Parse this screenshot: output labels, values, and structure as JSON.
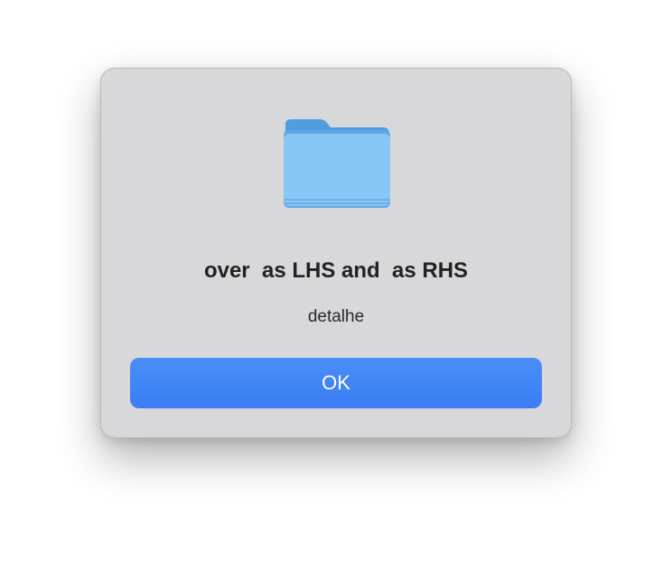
{
  "dialog": {
    "icon": "folder-icon",
    "title": "over  as LHS and  as RHS",
    "message": "detalhe",
    "ok_label": "OK"
  },
  "colors": {
    "dialog_background": "#d8d8da",
    "button_accent": "#3a7df5",
    "folder_blue": "#86c7f5"
  }
}
